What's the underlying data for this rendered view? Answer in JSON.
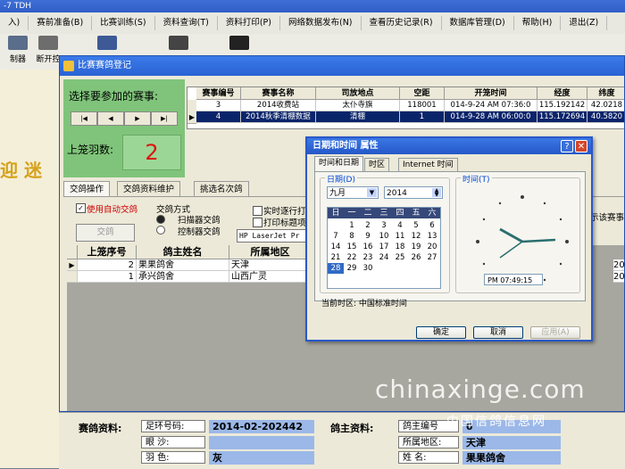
{
  "app": {
    "title": "-7 TDH",
    "menu": [
      "入)",
      "赛前准备(B)",
      "比赛训练(S)",
      "资料查询(T)",
      "资料打印(P)",
      "网络数据发布(N)",
      "查看历史记录(R)",
      "数据库管理(D)",
      "帮助(H)",
      "退出(Z)"
    ],
    "toolbar": [
      {
        "label": "制器"
      },
      {
        "label": "断开控"
      }
    ]
  },
  "background_text": "迎 迷",
  "main_window": {
    "title": "比赛赛鸽登记",
    "select_label": "选择要参加的赛事:",
    "nav_buttons": [
      "|◀",
      "◀",
      "▶",
      "▶|"
    ],
    "count_label": "上笼羽数:",
    "count_value": "2",
    "race_grid": {
      "headers": [
        "赛事编号",
        "赛事名称",
        "司放地点",
        "空距",
        "开笼时间",
        "经度",
        "纬度"
      ],
      "rows": [
        {
          "cells": [
            "3",
            "2014收费站",
            "太仆寺旗",
            "118001",
            "014-9-24 AM 07:36:0",
            "115.192142",
            "42.0218"
          ]
        },
        {
          "cells": [
            "4",
            "2014秋季清棚数据",
            "清棚",
            "1",
            "014-9-28 AM 06:00:0",
            "115.172694",
            "40.5820"
          ]
        }
      ]
    },
    "tabs": [
      "交鸽操作",
      "交鸽资料维护",
      "挑选名次鸽"
    ],
    "auto_checkin_label": "使用自动交鸽",
    "checkin_mode_label": "交鸽方式",
    "radio_options": [
      "扫描器交鸽",
      "控制器交鸽"
    ],
    "checkin_button": "交鸽",
    "options": [
      "实时逐行打",
      "打印标题项"
    ],
    "printer": "HP LaserJet Pr",
    "right_hint": "示该赛事",
    "pigeon_grid": {
      "headers": [
        "上笼序号",
        "鸽主姓名",
        "所属地区"
      ],
      "rows": [
        {
          "cells": [
            "2",
            "果果鸽舍",
            "天津"
          ]
        },
        {
          "cells": [
            "1",
            "承兴鸽舍",
            "山西广灵"
          ]
        }
      ],
      "right_cells": [
        "20",
        "20"
      ]
    }
  },
  "info_panel": {
    "pigeon_info_label": "赛鸽资料:",
    "ring_label": "足环号码:",
    "ring_value": "2014-02-202442",
    "eye_label": "眼    沙:",
    "feather_label": "羽    色:",
    "feather_value": "灰",
    "owner_info_label": "鸽主资料:",
    "owner_no_label": "鸽主编号",
    "owner_no_value": "0",
    "region_label": "所属地区:",
    "region_value": "天津",
    "name_label": "姓    名:",
    "name_value": "果果鸽舍"
  },
  "datetime_dialog": {
    "title": "日期和时间 属性",
    "help_btn": "?",
    "close_btn": "✕",
    "tabs": [
      "时间和日期",
      "时区",
      "Internet 时间"
    ],
    "date_group": "日期(D)",
    "time_group": "时间(T)",
    "month": "九月",
    "year": "2014",
    "weekdays": [
      "日",
      "一",
      "二",
      "三",
      "四",
      "五",
      "六"
    ],
    "days": [
      "",
      "1",
      "2",
      "3",
      "4",
      "5",
      "6",
      "7",
      "8",
      "9",
      "10",
      "11",
      "12",
      "13",
      "14",
      "15",
      "16",
      "17",
      "18",
      "19",
      "20",
      "21",
      "22",
      "23",
      "24",
      "25",
      "26",
      "27",
      "28",
      "29",
      "30",
      "",
      "",
      "",
      ""
    ],
    "selected_day": "28",
    "time": "PM    07:49:15",
    "timezone": "当前时区: 中国标准时间",
    "buttons": {
      "ok": "确定",
      "cancel": "取消",
      "apply": "应用(A)"
    }
  },
  "watermark": {
    "en": "chinaxinge.com",
    "cn": "中国信鸽信息网"
  }
}
